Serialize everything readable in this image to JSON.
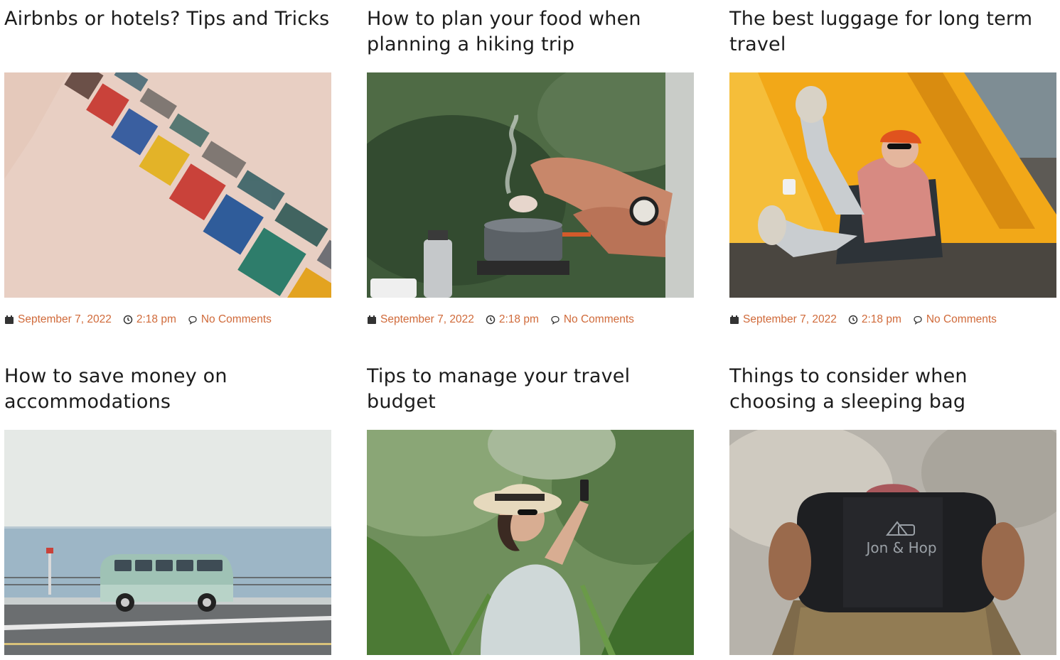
{
  "posts": [
    {
      "title": "Airbnbs or hotels? Tips and Tricks",
      "date": "September 7, 2022",
      "time": "2:18 pm",
      "comments": "No Comments",
      "image": "beach-huts-photo"
    },
    {
      "title": "How to plan your food when planning a hiking trip",
      "date": "September 7, 2022",
      "time": "2:18 pm",
      "comments": "No Comments",
      "image": "camp-stove-cooking-photo"
    },
    {
      "title": "The best luggage for long term travel",
      "date": "September 7, 2022",
      "time": "2:18 pm",
      "comments": "No Comments",
      "image": "tent-camping-woman-photo"
    },
    {
      "title": "How to save money on accommodations",
      "image": "vw-van-seaside-photo"
    },
    {
      "title": "Tips to manage your travel budget",
      "image": "woman-hat-plants-photo"
    },
    {
      "title": "Things to consider when choosing a sleeping bag",
      "image": "sleeping-bag-photo",
      "image_text": "Jon & Hop"
    }
  ],
  "colors": {
    "accent": "#d06a3a",
    "title": "#1c1c1c",
    "icon": "#333333"
  },
  "icons": {
    "date": "calendar-icon",
    "time": "clock-icon",
    "comments": "comment-icon"
  }
}
